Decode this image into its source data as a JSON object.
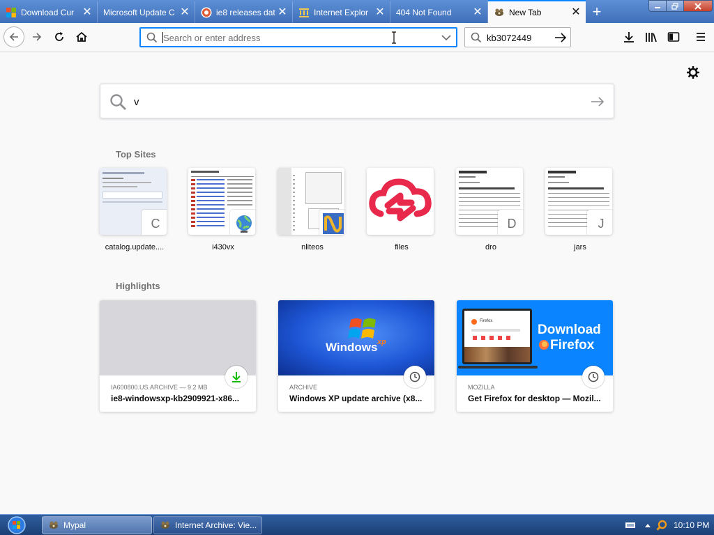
{
  "tabs": [
    {
      "title": "Download Cur",
      "favicon": "microsoft-logo-icon"
    },
    {
      "title": "Microsoft Update C",
      "favicon": "none"
    },
    {
      "title": "ie8 releases dat",
      "favicon": "duckduckgo-icon"
    },
    {
      "title": "Internet Explor",
      "favicon": "internet-archive-icon"
    },
    {
      "title": "404 Not Found",
      "favicon": "none"
    },
    {
      "title": "New Tab",
      "favicon": "mypal-icon",
      "active": true
    }
  ],
  "navbar": {
    "url_placeholder": "Search or enter address",
    "search_value": "kb3072449"
  },
  "newtab_search": {
    "value": "v"
  },
  "top_sites": {
    "heading": "Top Sites",
    "items": [
      {
        "label": "catalog.update....",
        "badge": "C"
      },
      {
        "label": "i430vx",
        "badge": ""
      },
      {
        "label": "nliteos",
        "badge": ""
      },
      {
        "label": "files",
        "badge": ""
      },
      {
        "label": "dro",
        "badge": "D"
      },
      {
        "label": "jars",
        "badge": "J"
      }
    ]
  },
  "highlights": {
    "heading": "Highlights",
    "items": [
      {
        "context": "IA600800.US.ARCHIVE — 9.2 MB",
        "title": "ie8-windowsxp-kb2909921-x86...",
        "icon": "download-icon"
      },
      {
        "context": "ARCHIVE",
        "title": "Windows XP update archive (x8...",
        "icon": "clock-icon"
      },
      {
        "context": "MOZILLA",
        "title": "Get Firefox for desktop — Mozil...",
        "icon": "clock-icon"
      }
    ],
    "thumb_text": {
      "windows": "Windows",
      "windows_xp": "xp",
      "firefox_line1": "Download",
      "firefox_line2": "Firefox",
      "firefox_small": "Firefox"
    }
  },
  "taskbar": {
    "tasks": [
      {
        "label": "Mypal"
      },
      {
        "label": "Internet Archive: Vie..."
      }
    ],
    "clock": "10:10 PM"
  },
  "colors": {
    "accent": "#0a84ff",
    "tabstrip": "#4f7fc8",
    "download_green": "#12bc00",
    "firefox_blue": "#0a84ff",
    "xp_blue": "#1e56d6"
  }
}
